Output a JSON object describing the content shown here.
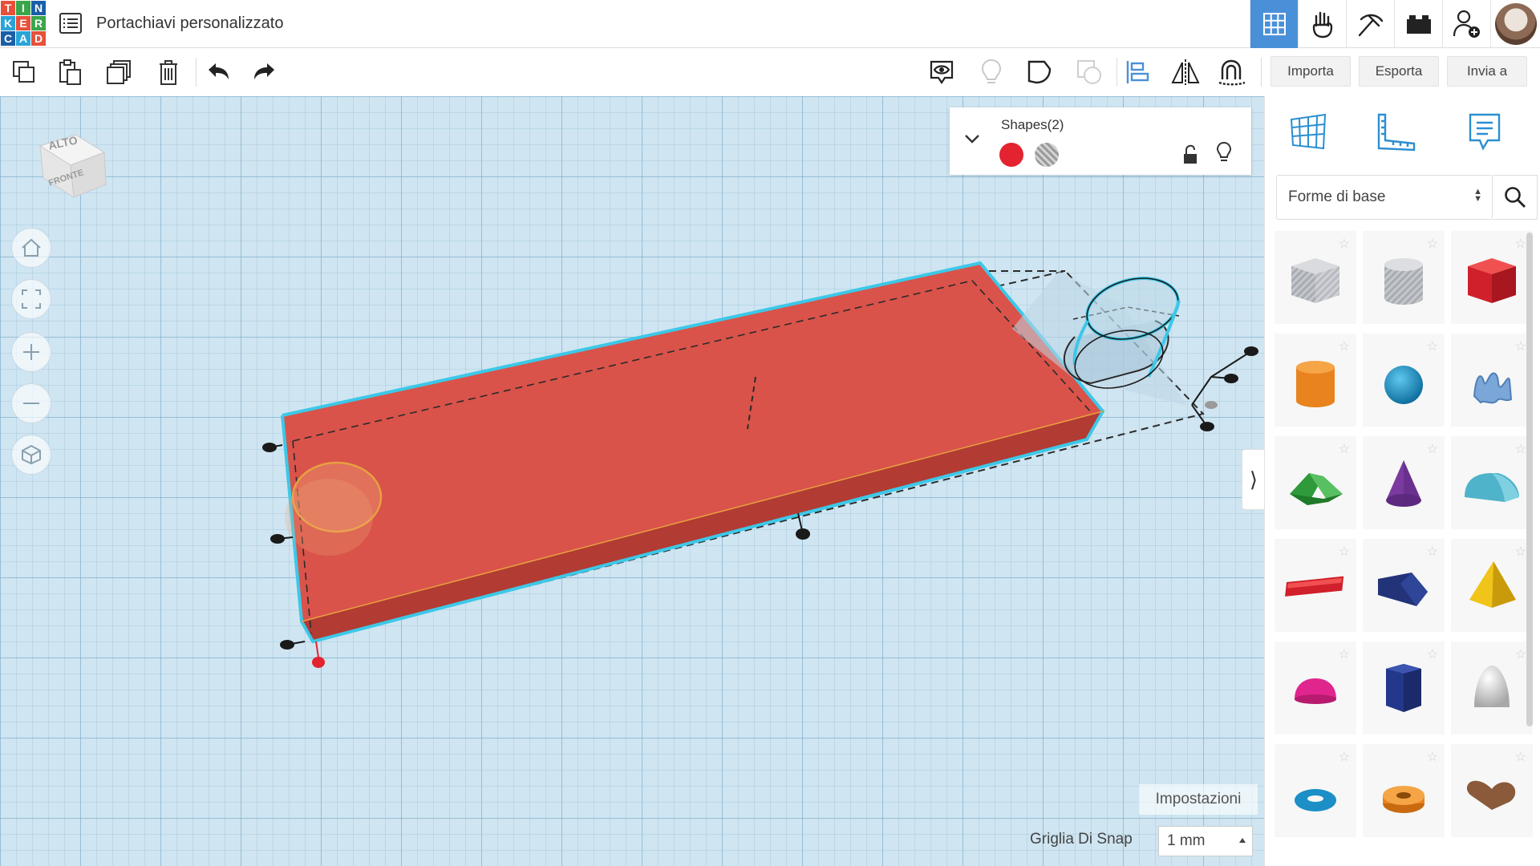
{
  "app": {
    "logo_letters": [
      "T",
      "I",
      "N",
      "K",
      "E",
      "R",
      "C",
      "A",
      "D"
    ],
    "document_title": "Portachiavi personalizzato"
  },
  "top_right": {
    "buttons": [
      "grid-view-icon",
      "gallery-hand-icon",
      "pickaxe-icon",
      "bricks-icon",
      "add-user-icon",
      "user-avatar"
    ],
    "active_color": "#4a90d9"
  },
  "toolbar": {
    "left_icons": [
      "copy-icon",
      "paste-icon",
      "duplicate-icon",
      "delete-icon",
      "undo-icon",
      "redo-icon"
    ],
    "right_icons": [
      "show-hide-icon",
      "light-bulb-icon",
      "note-icon",
      "group-icon",
      "align-icon",
      "mirror-icon",
      "ruler-magnet-icon"
    ],
    "import_label": "Importa",
    "export_label": "Esporta",
    "send_label": "Invia a"
  },
  "viewcube": {
    "top_label": "ALTO",
    "front_label": "FRONTE"
  },
  "nav_buttons": [
    "home-icon",
    "fit-view-icon",
    "zoom-in-icon",
    "zoom-out-icon",
    "perspective-icon"
  ],
  "shapes_panel": {
    "title": "Shapes(2)",
    "swatches": {
      "solid_color": "#e3232f",
      "hole": "striped-grey"
    }
  },
  "workplane": {
    "settings_label": "Impostazioni",
    "snap_label": "Griglia Di Snap",
    "snap_value": "1 mm"
  },
  "right_panel": {
    "top_icons": [
      "workplane-icon",
      "ruler-icon",
      "notes-icon"
    ],
    "library_select": "Forme di base",
    "shapes": [
      {
        "name": "box-hole",
        "color": "#b9bcc2"
      },
      {
        "name": "cylinder-hole",
        "color": "#b9bcc2"
      },
      {
        "name": "box",
        "color": "#e0202b"
      },
      {
        "name": "cylinder",
        "color": "#e8831e"
      },
      {
        "name": "sphere",
        "color": "#1b8fc6"
      },
      {
        "name": "scribble",
        "color": "#7aa6d8"
      },
      {
        "name": "roof",
        "color": "#2f9a3a"
      },
      {
        "name": "cone",
        "color": "#7b3aa0"
      },
      {
        "name": "round-roof",
        "color": "#4fb3c9"
      },
      {
        "name": "text",
        "color": "#d0202b"
      },
      {
        "name": "wedge",
        "color": "#22337a"
      },
      {
        "name": "pyramid",
        "color": "#f0c419"
      },
      {
        "name": "half-sphere",
        "color": "#e0268e"
      },
      {
        "name": "polygon",
        "color": "#23388a"
      },
      {
        "name": "paraboloid",
        "color": "#dcdcdc"
      },
      {
        "name": "torus",
        "color": "#1b8fc6"
      },
      {
        "name": "tube",
        "color": "#e8831e"
      },
      {
        "name": "heart",
        "color": "#8a5a3a"
      }
    ]
  }
}
